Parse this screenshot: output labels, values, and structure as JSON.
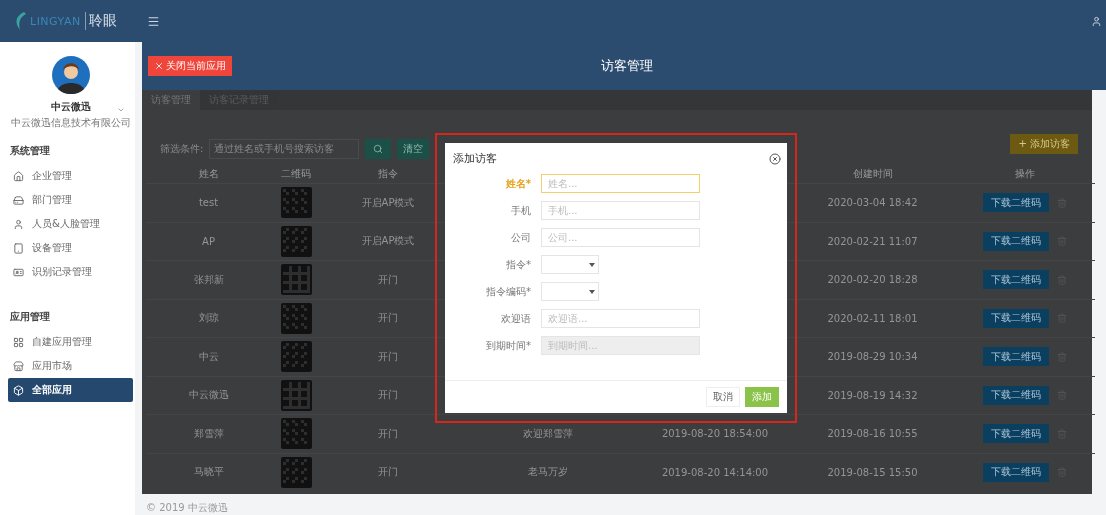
{
  "topbar": {
    "logo_latin": "LINGYAN",
    "logo_cjk": "聆眼"
  },
  "sidebar": {
    "user": {
      "name": "中云微迅",
      "company": "中云微迅信息技术有限公司"
    },
    "sections": [
      {
        "title": "系统管理",
        "items": [
          {
            "label": "企业管理",
            "selected": false
          },
          {
            "label": "部门管理",
            "selected": false
          },
          {
            "label": "人员&人脸管理",
            "selected": false
          },
          {
            "label": "设备管理",
            "selected": false
          },
          {
            "label": "识别记录管理",
            "selected": false
          }
        ]
      },
      {
        "title": "应用管理",
        "items": [
          {
            "label": "自建应用管理",
            "selected": false
          },
          {
            "label": "应用市场",
            "selected": false
          },
          {
            "label": "全部应用",
            "selected": true
          }
        ]
      }
    ]
  },
  "header": {
    "close_button": "关闭当前应用",
    "title": "访客管理"
  },
  "tabs": [
    {
      "label": "访客管理",
      "selected": true
    },
    {
      "label": "访客记录管理",
      "selected": false
    }
  ],
  "filter": {
    "label": "筛选条件:",
    "placeholder": "通过姓名或手机号搜索访客",
    "clear_button": "清空",
    "add_button": "+ 添加访客"
  },
  "table": {
    "columns": [
      "姓名",
      "二维码",
      "指令",
      "创建时间",
      "操作"
    ],
    "rows": [
      {
        "name": "test",
        "command": "开启AP模式",
        "created": "2020-03-04 18:42",
        "action": "下载二维码"
      },
      {
        "name": "AP",
        "command": "开启AP模式",
        "created": "2020-02-21 11:07",
        "action": "下载二维码"
      },
      {
        "name": "张邦新",
        "command": "开门",
        "created": "2020-02-20 18:28",
        "action": "下载二维码"
      },
      {
        "name": "刘琼",
        "command": "开门",
        "created": "2020-02-11 18:01",
        "action": "下载二维码"
      },
      {
        "name": "中云",
        "command": "开门",
        "created": "2019-08-29 10:34",
        "action": "下载二维码"
      },
      {
        "name": "中云微迅",
        "command": "开门",
        "created": "2019-08-19 14:32",
        "action": "下载二维码"
      },
      {
        "name": "郑雪萍",
        "command": "开门",
        "column_4": "欢迎郑雪萍",
        "column_5": "2019-08-20 18:54:00",
        "created": "2019-08-16 10:55",
        "action": "下载二维码"
      },
      {
        "name": "马晓平",
        "command": "开门",
        "column_4": "老马万岁",
        "column_5": "2019-08-20 14:14:00",
        "created": "2019-08-15 15:50",
        "action": "下载二维码"
      }
    ]
  },
  "dialog": {
    "title": "添加访客",
    "fields": [
      {
        "label": "姓名*",
        "kind": "text",
        "placeholder": "姓名...",
        "focused": true,
        "disabled": false
      },
      {
        "label": "手机",
        "kind": "text",
        "placeholder": "手机...",
        "focused": false,
        "disabled": false
      },
      {
        "label": "公司",
        "kind": "text",
        "placeholder": "公司...",
        "focused": false,
        "disabled": false
      },
      {
        "label": "指令*",
        "kind": "select",
        "focused": false,
        "disabled": false
      },
      {
        "label": "指令编码*",
        "kind": "select",
        "focused": false,
        "disabled": false
      },
      {
        "label": "欢迎语",
        "kind": "text",
        "placeholder": "欢迎语...",
        "focused": false,
        "disabled": false
      },
      {
        "label": "到期时间*",
        "kind": "text",
        "placeholder": "到期时间...",
        "focused": false,
        "disabled": true
      }
    ],
    "cancel_button": "取消",
    "submit_button": "添加"
  },
  "footer": "© 2019 中云微迅"
}
